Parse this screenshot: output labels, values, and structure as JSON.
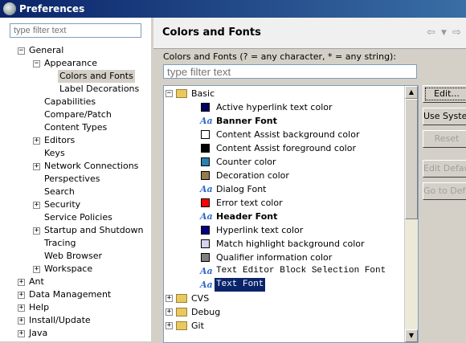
{
  "window": {
    "title": "Preferences"
  },
  "left": {
    "filter_placeholder": "type filter text",
    "tree": [
      {
        "label": "General",
        "level": 0,
        "toggle": "-"
      },
      {
        "label": "Appearance",
        "level": 1,
        "toggle": "-"
      },
      {
        "label": "Colors and Fonts",
        "level": 2,
        "toggle": "",
        "selected": true
      },
      {
        "label": "Label Decorations",
        "level": 2,
        "toggle": ""
      },
      {
        "label": "Capabilities",
        "level": 1,
        "toggle": ""
      },
      {
        "label": "Compare/Patch",
        "level": 1,
        "toggle": ""
      },
      {
        "label": "Content Types",
        "level": 1,
        "toggle": ""
      },
      {
        "label": "Editors",
        "level": 1,
        "toggle": "+"
      },
      {
        "label": "Keys",
        "level": 1,
        "toggle": ""
      },
      {
        "label": "Network Connections",
        "level": 1,
        "toggle": "+"
      },
      {
        "label": "Perspectives",
        "level": 1,
        "toggle": ""
      },
      {
        "label": "Search",
        "level": 1,
        "toggle": ""
      },
      {
        "label": "Security",
        "level": 1,
        "toggle": "+"
      },
      {
        "label": "Service Policies",
        "level": 1,
        "toggle": ""
      },
      {
        "label": "Startup and Shutdown",
        "level": 1,
        "toggle": "+"
      },
      {
        "label": "Tracing",
        "level": 1,
        "toggle": ""
      },
      {
        "label": "Web Browser",
        "level": 1,
        "toggle": ""
      },
      {
        "label": "Workspace",
        "level": 1,
        "toggle": "+"
      },
      {
        "label": "Ant",
        "level": 0,
        "toggle": "+"
      },
      {
        "label": "Data Management",
        "level": 0,
        "toggle": "+"
      },
      {
        "label": "Help",
        "level": 0,
        "toggle": "+"
      },
      {
        "label": "Install/Update",
        "level": 0,
        "toggle": "+"
      },
      {
        "label": "Java",
        "level": 0,
        "toggle": "+"
      }
    ]
  },
  "right": {
    "title": "Colors and Fonts",
    "nav_icons": [
      "back-arrow-icon",
      "menu-dropdown-icon",
      "forward-arrow-icon"
    ],
    "description": "Colors and Fonts (? = any character, * = any string):",
    "filter_placeholder": "type filter text",
    "categories": [
      {
        "label": "Basic",
        "expanded": true,
        "items": [
          {
            "label": "Active hyperlink text color",
            "kind": "color",
            "color": "#000060"
          },
          {
            "label": "Banner Font",
            "kind": "font",
            "style": "bold"
          },
          {
            "label": "Content Assist background color",
            "kind": "color",
            "color": "#ffffff"
          },
          {
            "label": "Content Assist foreground color",
            "kind": "color",
            "color": "#000000"
          },
          {
            "label": "Counter color",
            "kind": "color",
            "color": "#2a7fb0"
          },
          {
            "label": "Decoration color",
            "kind": "color",
            "color": "#957b4e"
          },
          {
            "label": "Dialog Font",
            "kind": "font",
            "style": "normal"
          },
          {
            "label": "Error text color",
            "kind": "color",
            "color": "#ff0000"
          },
          {
            "label": "Header Font",
            "kind": "font",
            "style": "bold"
          },
          {
            "label": "Hyperlink text color",
            "kind": "color",
            "color": "#000080"
          },
          {
            "label": "Match highlight background color",
            "kind": "color",
            "color": "#d4d4f0"
          },
          {
            "label": "Qualifier information color",
            "kind": "color",
            "color": "#808080"
          },
          {
            "label": "Text Editor Block Selection Font",
            "kind": "font",
            "style": "mono"
          },
          {
            "label": "Text Font",
            "kind": "font",
            "style": "mono",
            "selected": true
          }
        ]
      },
      {
        "label": "CVS",
        "expanded": false
      },
      {
        "label": "Debug",
        "expanded": false
      },
      {
        "label": "Git",
        "expanded": false
      }
    ],
    "buttons": [
      {
        "label": "Edit...",
        "enabled": true
      },
      {
        "label": "Use System Font",
        "enabled": true
      },
      {
        "label": "Reset",
        "enabled": false
      },
      {
        "label": "Edit Default...",
        "enabled": false
      },
      {
        "label": "Go to Default",
        "enabled": false
      }
    ]
  },
  "colors": {
    "selection_bg": "#0a246a",
    "selection_fg": "#ffffff",
    "title_start": "#0a246a",
    "title_end": "#3a6ea5"
  }
}
